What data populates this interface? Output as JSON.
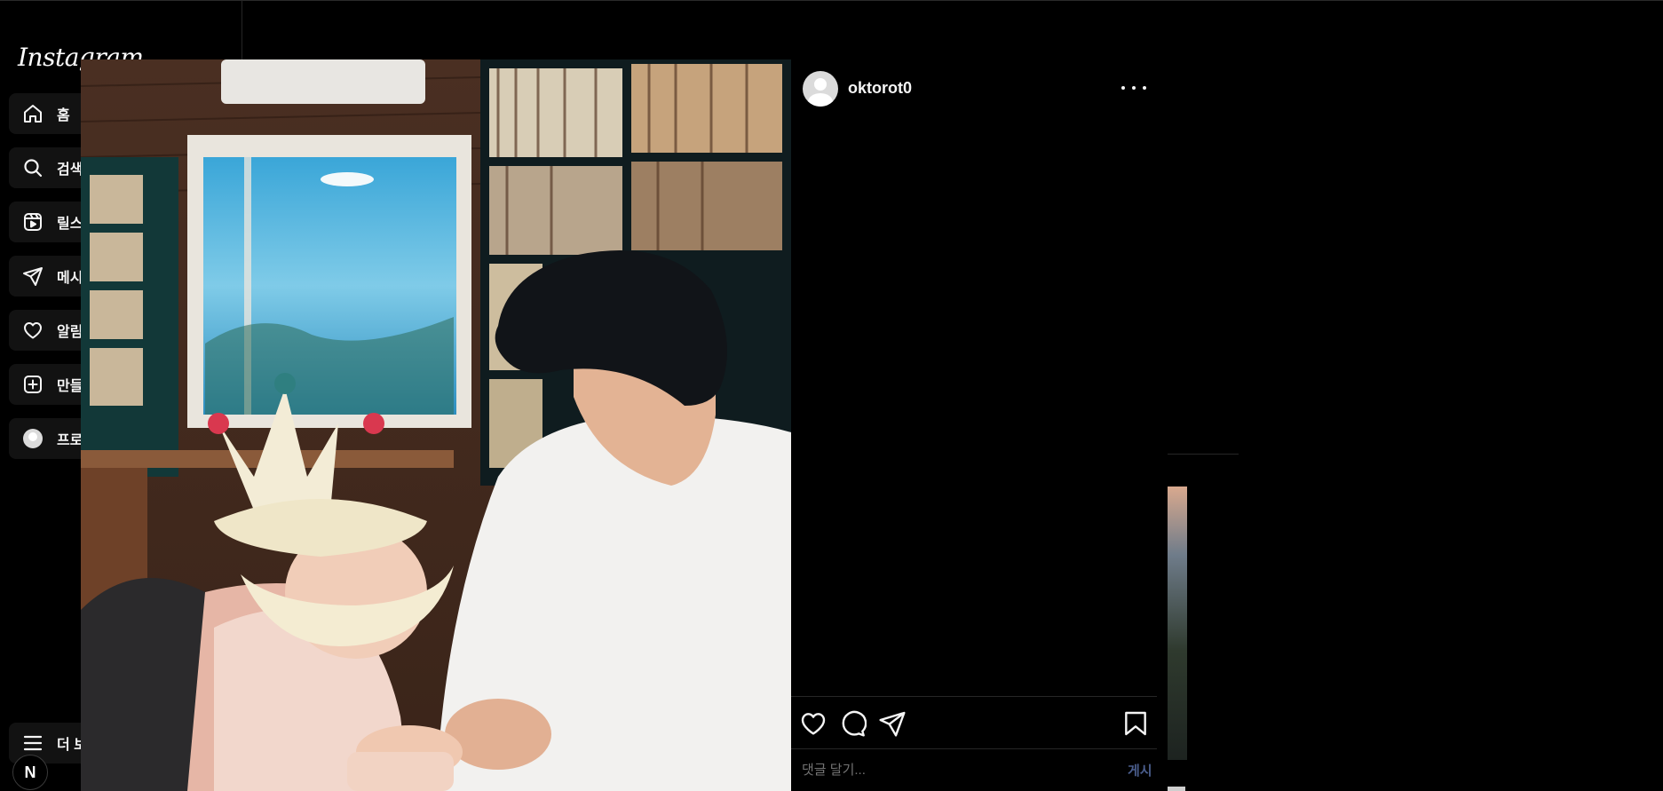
{
  "app": {
    "logo_text": "Instagram"
  },
  "sidebar": {
    "items": [
      {
        "label": "홈",
        "icon": "home-icon"
      },
      {
        "label": "검색",
        "icon": "search-icon"
      },
      {
        "label": "릴스",
        "icon": "reels-icon"
      },
      {
        "label": "메시지",
        "icon": "send-icon"
      },
      {
        "label": "알림",
        "icon": "heart-icon"
      },
      {
        "label": "만들기",
        "icon": "plus-square-icon"
      },
      {
        "label": "프로필",
        "icon": "avatar"
      }
    ],
    "more_label": "더 보기",
    "badge_text": "N"
  },
  "post": {
    "username": "oktorot0",
    "comment_placeholder": "댓글 달기...",
    "post_button": "게시"
  },
  "colors": {
    "background": "#000000",
    "nav_item_bg": "#121212",
    "post_button": "#4a5d8c"
  }
}
